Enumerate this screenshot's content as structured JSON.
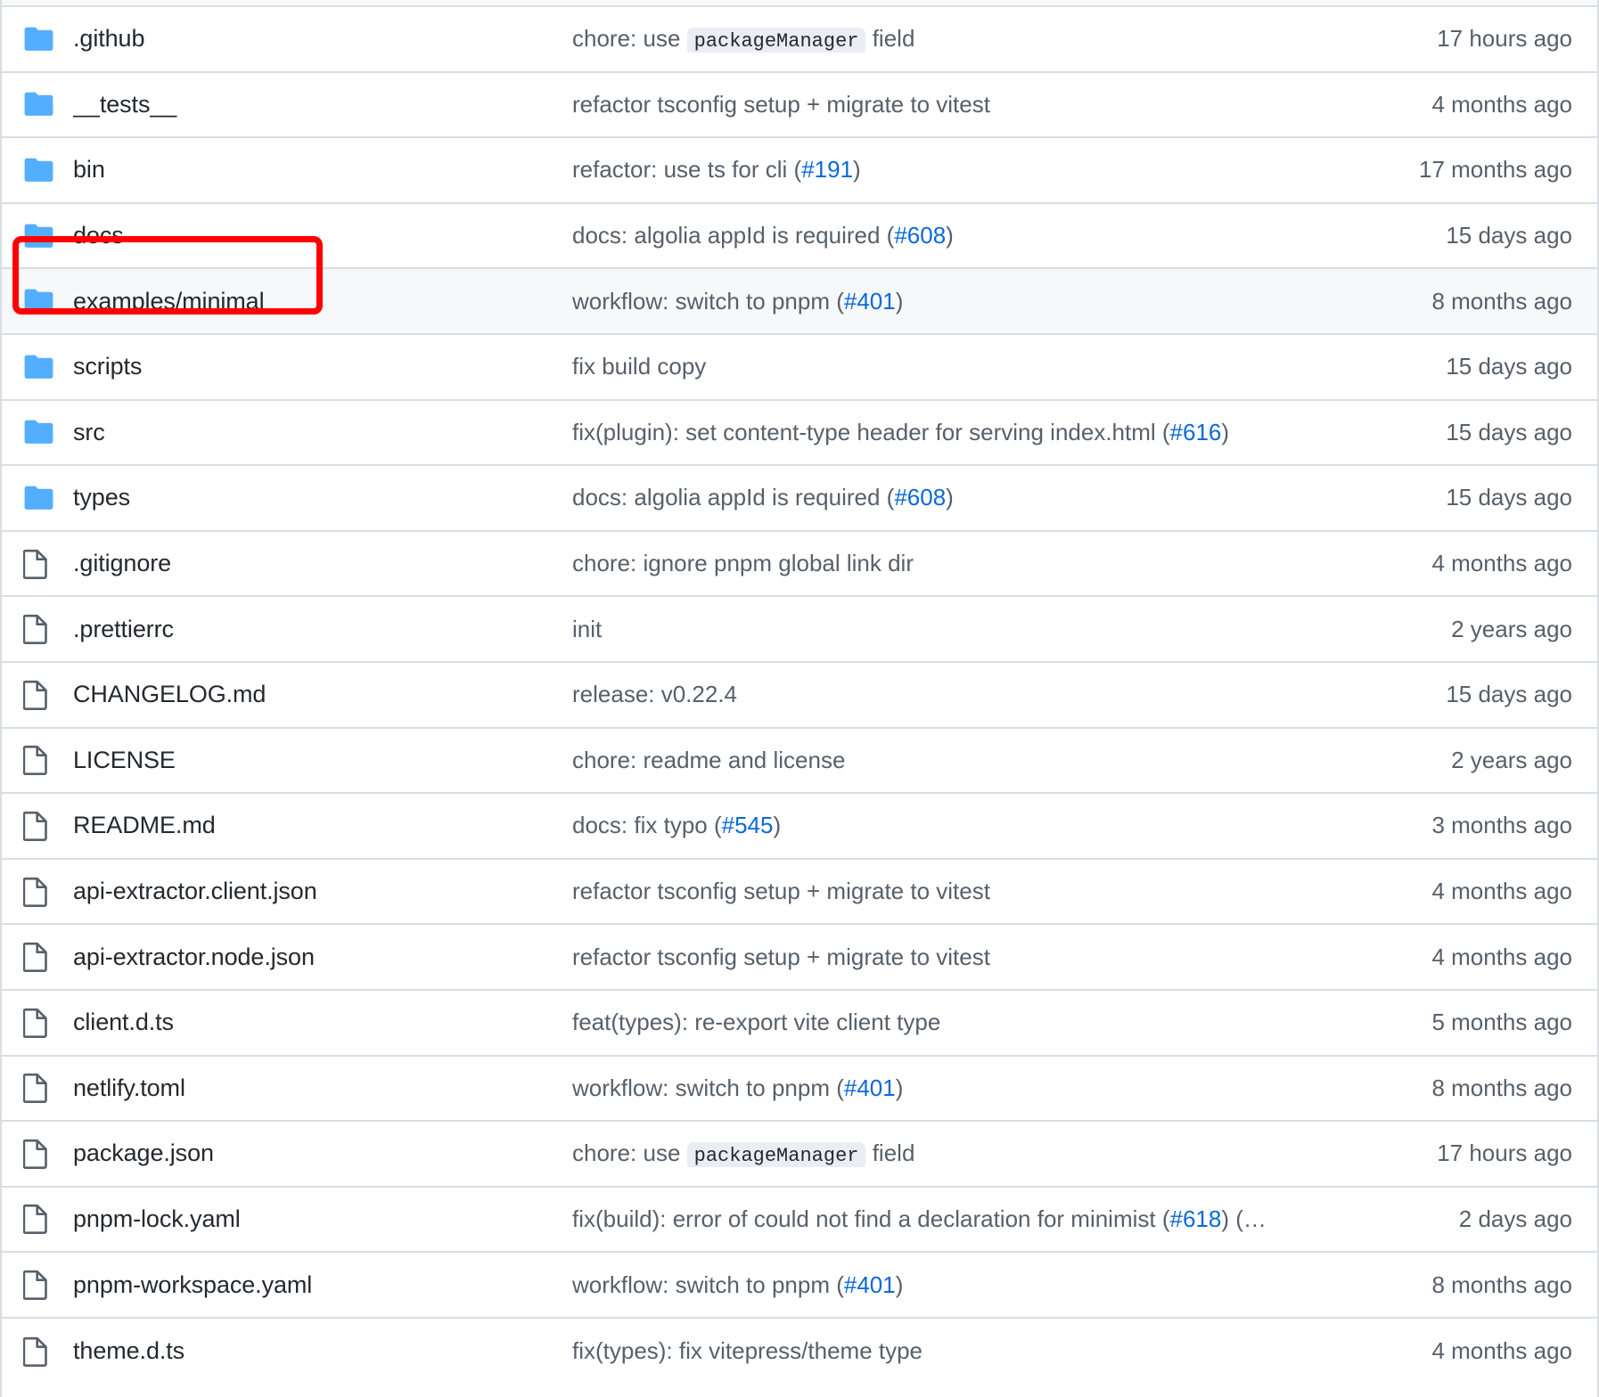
{
  "view": {
    "kind": "repository-file-listing",
    "accent_link_color": "#0969da",
    "folder_icon_color": "#54aeff",
    "file_icon_color": "#57606a",
    "highlight_box_color": "#ff0000",
    "highlighted_row_background": "#f6f8fa",
    "highlighted_row_name": "examples/minimal"
  },
  "rows": [
    {
      "icon": "folder-icon",
      "name": ".github",
      "message_prefix": "chore: use ",
      "code": "packageManager",
      "message_suffix": " field",
      "time": "17 hours ago"
    },
    {
      "icon": "folder-icon",
      "name": "__tests__",
      "message_prefix": "refactor tsconfig setup + migrate to vitest",
      "code": "",
      "message_suffix": "",
      "time": "4 months ago"
    },
    {
      "icon": "folder-icon",
      "name": "bin",
      "message_prefix": "refactor: use ts for cli (",
      "link": "#191",
      "message_suffix": ")",
      "time": "17 months ago"
    },
    {
      "icon": "folder-icon",
      "name": "docs",
      "message_prefix": "docs: algolia appId is required (",
      "link": "#608",
      "message_suffix": ")",
      "time": "15 days ago"
    },
    {
      "icon": "folder-icon",
      "name": "examples/minimal",
      "message_prefix": "workflow: switch to pnpm (",
      "link": "#401",
      "message_suffix": ")",
      "time": "8 months ago",
      "highlighted": true
    },
    {
      "icon": "folder-icon",
      "name": "scripts",
      "message_prefix": "fix build copy",
      "code": "",
      "message_suffix": "",
      "time": "15 days ago"
    },
    {
      "icon": "folder-icon",
      "name": "src",
      "message_prefix": "fix(plugin): set content-type header for serving index.html (",
      "link": "#616",
      "message_suffix": ")",
      "time": "15 days ago"
    },
    {
      "icon": "folder-icon",
      "name": "types",
      "message_prefix": "docs: algolia appId is required (",
      "link": "#608",
      "message_suffix": ")",
      "time": "15 days ago"
    },
    {
      "icon": "file-icon",
      "name": ".gitignore",
      "message_prefix": "chore: ignore pnpm global link dir",
      "code": "",
      "message_suffix": "",
      "time": "4 months ago"
    },
    {
      "icon": "file-icon",
      "name": ".prettierrc",
      "message_prefix": "init",
      "code": "",
      "message_suffix": "",
      "time": "2 years ago"
    },
    {
      "icon": "file-icon",
      "name": "CHANGELOG.md",
      "message_prefix": "release: v0.22.4",
      "code": "",
      "message_suffix": "",
      "time": "15 days ago"
    },
    {
      "icon": "file-icon",
      "name": "LICENSE",
      "message_prefix": "chore: readme and license",
      "code": "",
      "message_suffix": "",
      "time": "2 years ago"
    },
    {
      "icon": "file-icon",
      "name": "README.md",
      "message_prefix": "docs: fix typo (",
      "link": "#545",
      "message_suffix": ")",
      "time": "3 months ago"
    },
    {
      "icon": "file-icon",
      "name": "api-extractor.client.json",
      "message_prefix": "refactor tsconfig setup + migrate to vitest",
      "code": "",
      "message_suffix": "",
      "time": "4 months ago"
    },
    {
      "icon": "file-icon",
      "name": "api-extractor.node.json",
      "message_prefix": "refactor tsconfig setup + migrate to vitest",
      "code": "",
      "message_suffix": "",
      "time": "4 months ago"
    },
    {
      "icon": "file-icon",
      "name": "client.d.ts",
      "message_prefix": "feat(types): re-export vite client type",
      "code": "",
      "message_suffix": "",
      "time": "5 months ago"
    },
    {
      "icon": "file-icon",
      "name": "netlify.toml",
      "message_prefix": "workflow: switch to pnpm (",
      "link": "#401",
      "message_suffix": ")",
      "time": "8 months ago"
    },
    {
      "icon": "file-icon",
      "name": "package.json",
      "message_prefix": "chore: use ",
      "code": "packageManager",
      "message_suffix": " field",
      "time": "17 hours ago"
    },
    {
      "icon": "file-icon",
      "name": "pnpm-lock.yaml",
      "message_prefix": "fix(build): error of could not find a declaration for minimist (",
      "link": "#618",
      "message_suffix": ") (…",
      "time": "2 days ago"
    },
    {
      "icon": "file-icon",
      "name": "pnpm-workspace.yaml",
      "message_prefix": "workflow: switch to pnpm (",
      "link": "#401",
      "message_suffix": ")",
      "time": "8 months ago"
    },
    {
      "icon": "file-icon",
      "name": "theme.d.ts",
      "message_prefix": "fix(types): fix vitepress/theme type",
      "code": "",
      "message_suffix": "",
      "time": "4 months ago"
    }
  ]
}
